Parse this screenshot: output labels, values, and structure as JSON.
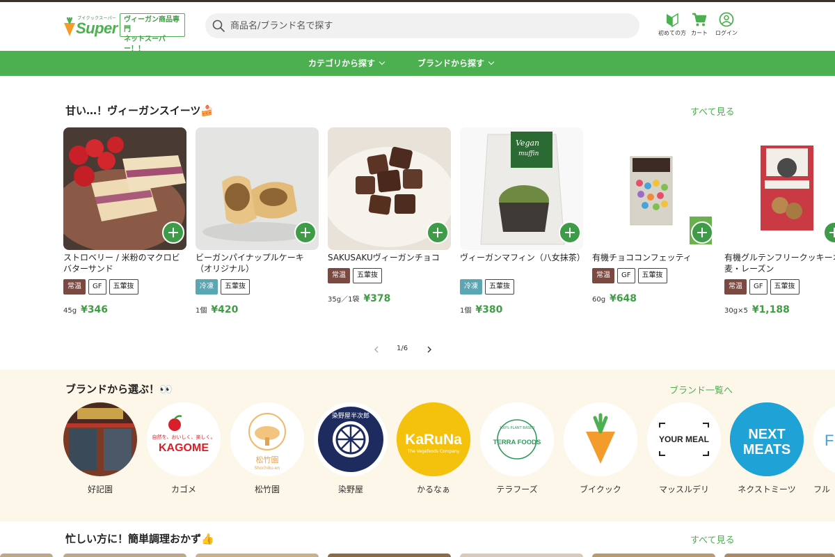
{
  "header": {
    "logo_small": "ブイクックスーパー",
    "logo_text": "Super",
    "tagline": "ヴィーガン商品専門\nネットスーパー！！",
    "search_placeholder": "商品名/ブランド名で探す",
    "buttons": [
      {
        "label": "初めての方",
        "icon": "beginner-mark-icon"
      },
      {
        "label": "カート",
        "icon": "cart-icon"
      },
      {
        "label": "ログイン",
        "icon": "user-icon"
      }
    ]
  },
  "nav": {
    "category": "カテゴリから探す",
    "brand": "ブランドから探す"
  },
  "sweets": {
    "title": "甘い…！ヴィーガンスイーツ🍰",
    "see_all": "すべて見る",
    "pager": "1/6",
    "products": [
      {
        "name": "ストロベリー / 米粉のマクロビバターサンド",
        "badges": [
          "常温",
          "GF",
          "五葷抜"
        ],
        "qty": "45g",
        "price": "¥346"
      },
      {
        "name": "ビーガンパイナップルケーキ（オリジナル）",
        "badges": [
          "冷凍",
          "五葷抜"
        ],
        "qty": "1個",
        "price": "¥420"
      },
      {
        "name": "SAKUSAKUヴィーガンチョコ",
        "badges": [
          "常温",
          "五葷抜"
        ],
        "qty": "35g／1袋",
        "price": "¥378"
      },
      {
        "name": "ヴィーガンマフィン（八女抹茶）",
        "badges": [
          "冷凍",
          "五葷抜"
        ],
        "qty": "1個",
        "price": "¥380"
      },
      {
        "name": "有機チョココンフェッティ",
        "badges": [
          "常温",
          "GF",
          "五葷抜"
        ],
        "qty": "60g",
        "price": "¥648"
      },
      {
        "name": "有機グルテンフリークッキーオーツ麦・レーズン",
        "badges": [
          "常温",
          "GF",
          "五葷抜"
        ],
        "qty": "30g×5",
        "price": "¥1,188"
      }
    ]
  },
  "brands": {
    "title": "ブランドから選ぶ！👀",
    "see_all": "ブランド一覧へ",
    "items": [
      {
        "name": "好記園",
        "logo_text": ""
      },
      {
        "name": "カゴメ",
        "logo_text": "KAGOME",
        "logo_sub": "自然を、おいしく、楽しく。"
      },
      {
        "name": "松竹園",
        "logo_text": "松竹園",
        "logo_sub": "Shochiku-en"
      },
      {
        "name": "染野屋",
        "logo_text": "染野屋半次郎"
      },
      {
        "name": "かるなぁ",
        "logo_text": "KaRuNa",
        "logo_sub": "The Vegefoods Company"
      },
      {
        "name": "テラフーズ",
        "logo_text": "TERRA FOODS",
        "logo_sub": "100% PLANT BASED"
      },
      {
        "name": "ブイクック",
        "logo_text": ""
      },
      {
        "name": "マッスルデリ",
        "logo_text": "YOUR MEAL"
      },
      {
        "name": "ネクストミーツ",
        "logo_text": "NEXT MEATS"
      },
      {
        "name": "フル",
        "logo_text": "F"
      }
    ]
  },
  "quick": {
    "title": "忙しい方に！簡単調理おかず👍",
    "see_all": "すべて見る"
  },
  "colors": {
    "brand_green": "#4caf50",
    "price_green": "#3f9e44",
    "room_temp_badge": "#7a4a42",
    "frozen_badge": "#5ba6b3",
    "brand_section_bg": "#fdf7ea"
  }
}
